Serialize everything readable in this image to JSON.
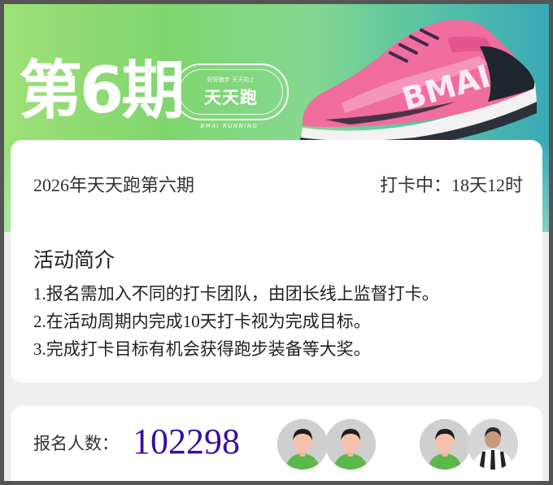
{
  "banner": {
    "issue_label": "第6期",
    "badge_slogan": "好好跑步 天天向上",
    "badge_name": "天天跑",
    "badge_brand": "BMAI RUNNING",
    "shoe_brand": "BMAI"
  },
  "activity": {
    "title": "2026年天天跑第六期",
    "status": "打卡中：18天12时"
  },
  "intro": {
    "heading": "活动简介",
    "rules": [
      "1.报名需加入不同的打卡团队，由团长线上监督打卡。",
      "2.在活动周期内完成10天打卡视为完成目标。",
      "3.完成打卡目标有机会获得跑步装备等大奖。"
    ]
  },
  "signup": {
    "label": "报名人数：",
    "count": "102298",
    "avatars": [
      "default-avatar",
      "default-avatar",
      "default-avatar",
      "photo-avatar"
    ]
  },
  "colors": {
    "count_color": "#3a0da0",
    "banner_green": "#86d890",
    "banner_teal": "#3aa9b8",
    "shoe_pink": "#f06d9e"
  }
}
